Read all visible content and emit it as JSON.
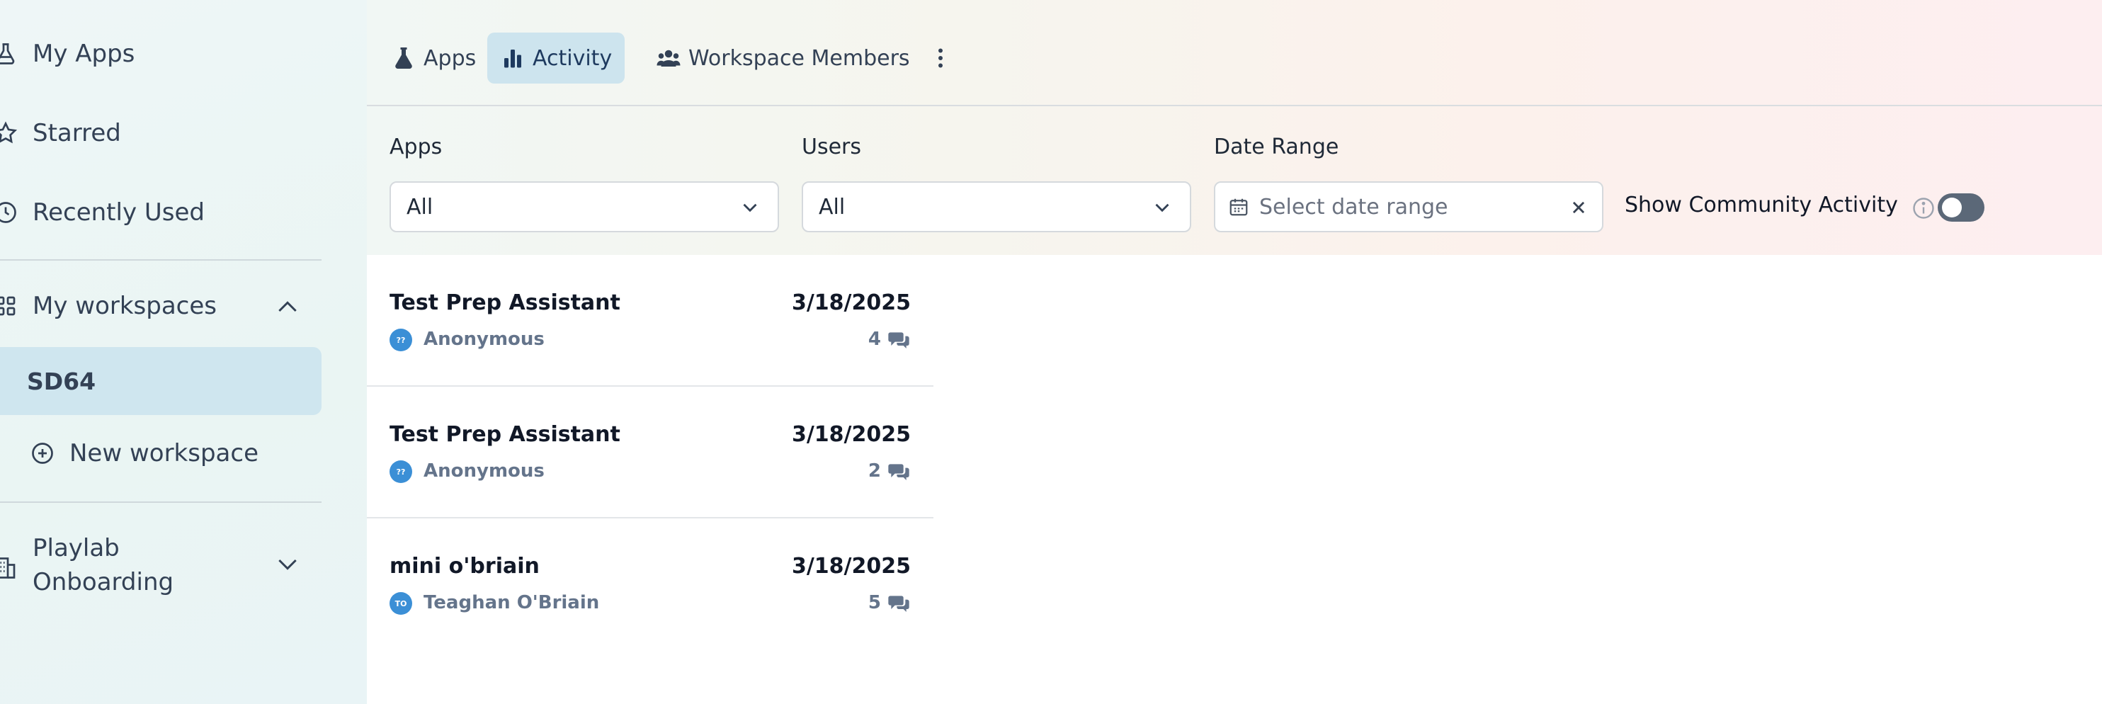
{
  "sidebar": {
    "items": [
      {
        "label": "My Apps",
        "icon": "flask-icon"
      },
      {
        "label": "Starred",
        "icon": "star-icon"
      },
      {
        "label": "Recently Used",
        "icon": "clock-icon"
      }
    ],
    "workspaces_label": "My workspaces",
    "selected_workspace": "SD64",
    "new_workspace_label": "New workspace",
    "org_label": "Playlab Onboarding"
  },
  "tabs": [
    {
      "label": "Apps",
      "icon": "flask-icon",
      "active": false
    },
    {
      "label": "Activity",
      "icon": "bar-chart-icon",
      "active": true
    },
    {
      "label": "Workspace Members",
      "icon": "users-icon",
      "active": false
    }
  ],
  "filters": {
    "apps": {
      "label": "Apps",
      "value": "All"
    },
    "users": {
      "label": "Users",
      "value": "All"
    },
    "date_range": {
      "label": "Date Range",
      "placeholder": "Select date range"
    },
    "community_label": "Show Community Activity",
    "community_enabled": false
  },
  "activity": [
    {
      "app": "Test Prep Assistant",
      "date": "3/18/2025",
      "user": "Anonymous",
      "initials": "??",
      "count": "4"
    },
    {
      "app": "Test Prep Assistant",
      "date": "3/18/2025",
      "user": "Anonymous",
      "initials": "??",
      "count": "2"
    },
    {
      "app": "mini o'briain",
      "date": "3/18/2025",
      "user": "Teaghan O'Briain",
      "initials": "TO",
      "count": "5"
    }
  ],
  "colors": {
    "accent": "#cde4ee",
    "toggle_off": "#5b6878",
    "avatar": "#3b8fd6"
  }
}
